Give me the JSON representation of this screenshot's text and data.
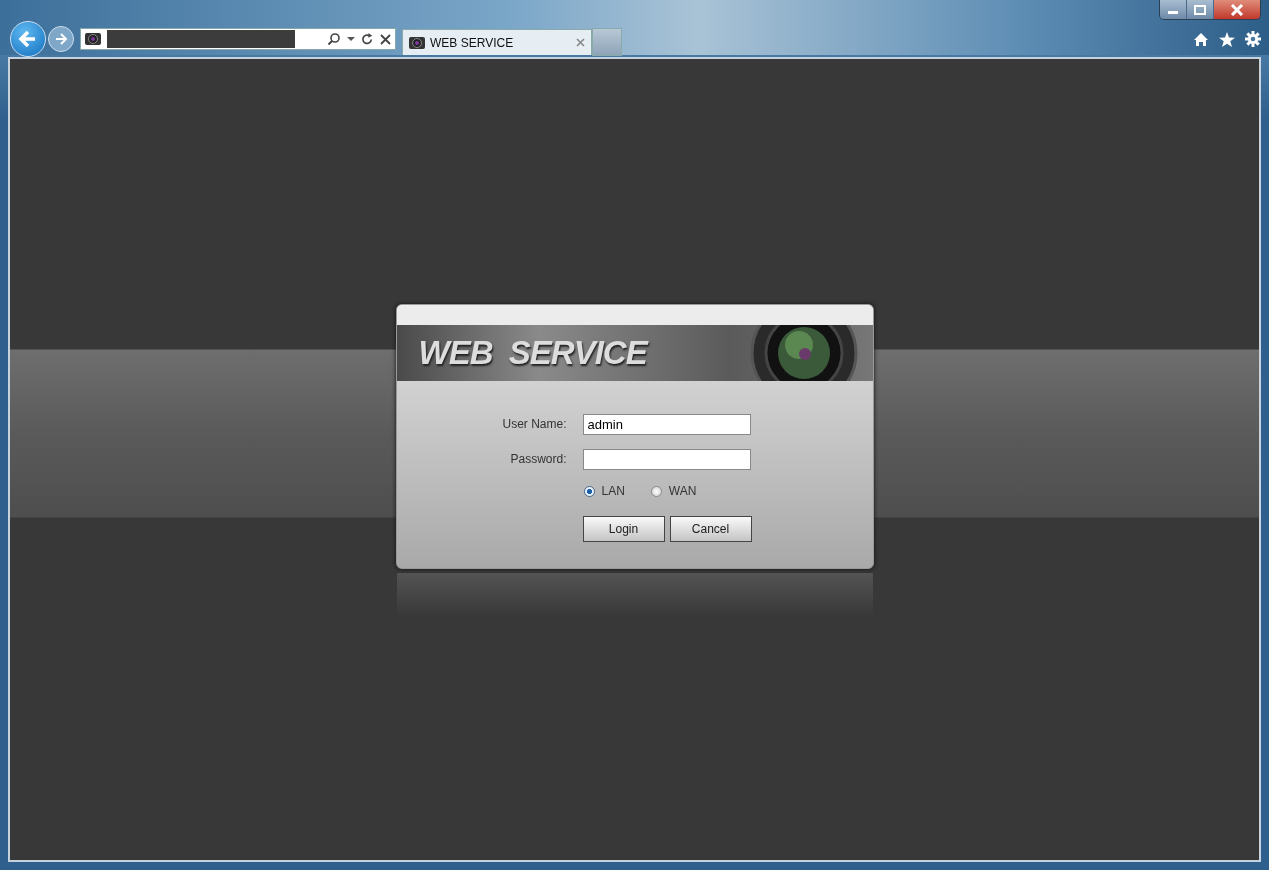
{
  "browser": {
    "tab": {
      "title": "WEB SERVICE",
      "selected": true
    }
  },
  "login": {
    "banner_title": "WEB  SERVICE",
    "fields": [
      {
        "label": "User Name:",
        "value": "admin"
      },
      {
        "label": "Password:"
      }
    ],
    "network": [
      {
        "label": "LAN",
        "selected": true
      },
      {
        "label": "WAN",
        "selected": false
      }
    ],
    "buttons": [
      "Login",
      "Cancel"
    ]
  }
}
